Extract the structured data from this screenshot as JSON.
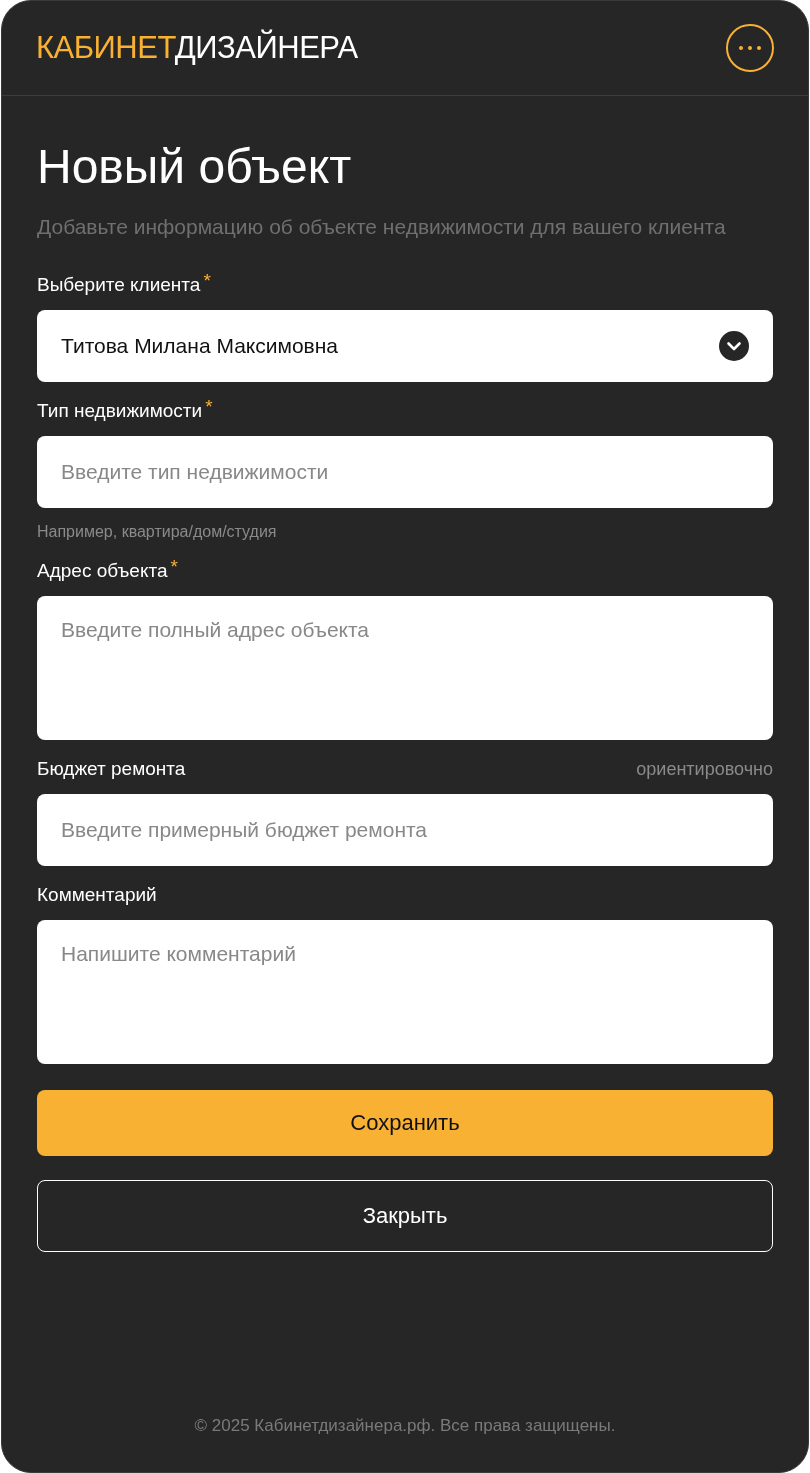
{
  "header": {
    "logo_accent": "КАБИНЕТ",
    "logo_rest": "ДИЗАЙНЕРА"
  },
  "title": "Новый объект",
  "subtitle": "Добавьте информацию об объекте недвижимости для вашего клиента",
  "fields": [
    {
      "kind": "select",
      "label": "Выберите клиента",
      "required_mark": "*",
      "value": "Титова Милана Максимовна"
    },
    {
      "kind": "input",
      "label": "Тип недвижимости",
      "required_mark": "*",
      "placeholder": "Введите тип недвижимости",
      "hint": "Например, квартира/дом/студия"
    },
    {
      "kind": "textarea",
      "label": "Адрес объекта",
      "required_mark": "*",
      "placeholder": "Введите полный адрес объекта"
    },
    {
      "kind": "input",
      "label": "Бюджет ремонта",
      "note": "ориентировочно",
      "placeholder": "Введите примерный бюджет ремонта"
    },
    {
      "kind": "textarea",
      "label": "Комментарий",
      "placeholder": "Напишите комментарий"
    }
  ],
  "buttons": [
    {
      "kind": "primary",
      "label": "Сохранить"
    },
    {
      "kind": "secondary",
      "label": "Закрыть"
    }
  ],
  "footer": "© 2025 Кабинетдизайнера.рф. Все права защищены."
}
